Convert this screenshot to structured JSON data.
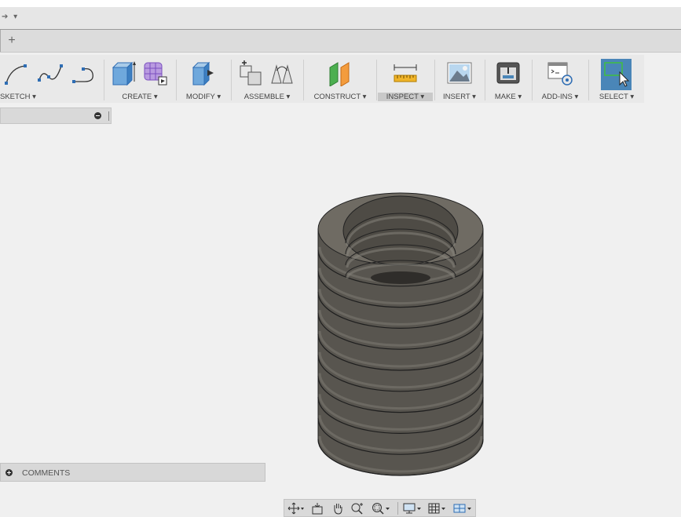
{
  "window": {
    "nav_arrows": "➔ ▾"
  },
  "tabs": {
    "new_tab": "+"
  },
  "toolbar": {
    "groups": [
      {
        "label": "SKETCH ▾",
        "icons": [
          "arc-icon",
          "spline-icon",
          "conic-curve-icon"
        ]
      },
      {
        "label": "CREATE ▾",
        "icons": [
          "extrude-box-icon",
          "form-icon"
        ]
      },
      {
        "label": "MODIFY ▾",
        "icons": [
          "press-pull-icon"
        ]
      },
      {
        "label": "ASSEMBLE ▾",
        "icons": [
          "new-component-icon",
          "joint-icon"
        ]
      },
      {
        "label": "CONSTRUCT ▾",
        "icons": [
          "plane-icon"
        ]
      },
      {
        "label": "INSPECT ▾",
        "icons": [
          "measure-icon"
        ],
        "active": true
      },
      {
        "label": "INSERT ▾",
        "icons": [
          "insert-image-icon"
        ]
      },
      {
        "label": "MAKE ▾",
        "icons": [
          "3d-print-icon"
        ]
      },
      {
        "label": "ADD-INS ▾",
        "icons": [
          "scripts-addins-icon"
        ]
      },
      {
        "label": "SELECT ▾",
        "icons": [
          "select-icon"
        ],
        "selected": true
      }
    ],
    "accent": "#4a86b8"
  },
  "browser_panel": {
    "collapse_icon": "minus-circle-icon"
  },
  "comments_panel": {
    "label": "COMMENTS",
    "expand_icon": "plus-circle-icon"
  },
  "navigation_bar": {
    "items": [
      "orbit-icon",
      "look-at-icon",
      "pan-icon",
      "zoom-icon",
      "fit-icon",
      "display-settings-icon",
      "grid-settings-icon",
      "viewports-icon"
    ]
  },
  "model": {
    "name": "",
    "color": "#6f6b63",
    "rings": 10
  }
}
